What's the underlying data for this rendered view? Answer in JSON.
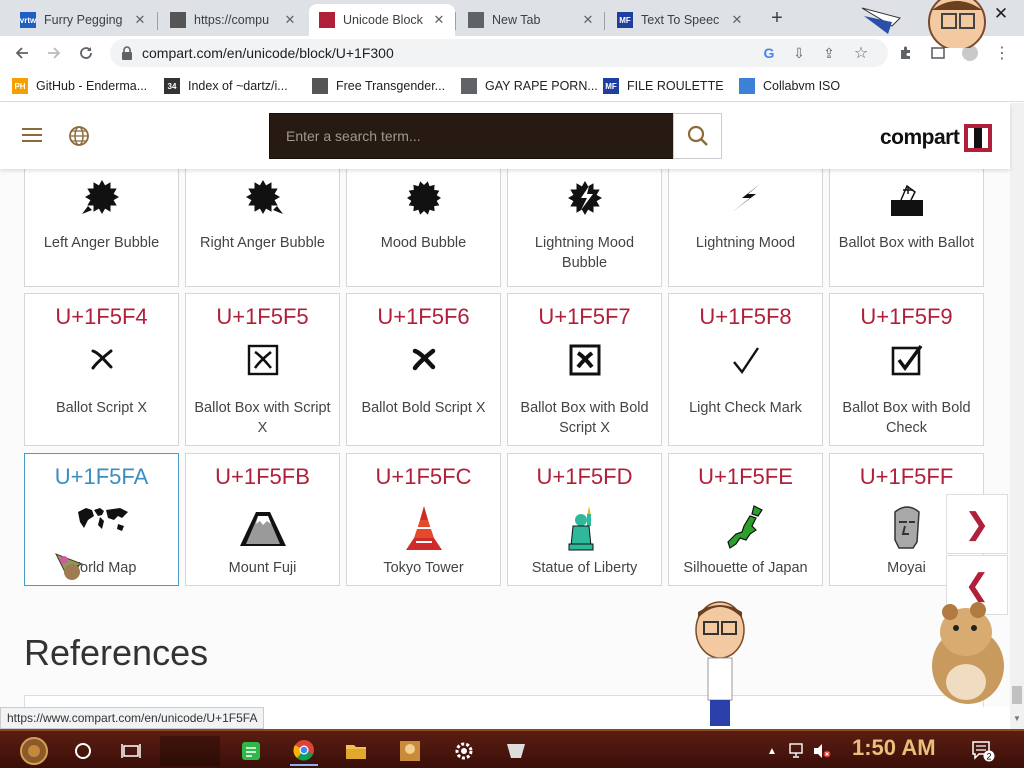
{
  "browser": {
    "tabs": [
      {
        "title": "Furry Pegging V",
        "fav_text": "vrtw",
        "fav_color": "#1f5fbf"
      },
      {
        "title": "https://compu",
        "fav_text": "",
        "fav_color": "#555"
      },
      {
        "title": "Unicode Block",
        "fav_text": "",
        "fav_color": "#b0203a"
      },
      {
        "title": "New Tab",
        "fav_text": "",
        "fav_color": "#5f6368"
      },
      {
        "title": "Text To Speec",
        "fav_text": "MF",
        "fav_color": "#1f3fa0"
      }
    ],
    "active_tab_index": 2,
    "url": "compart.com/en/unicode/block/U+1F300",
    "bookmarks": [
      {
        "label": "GitHub - Enderma...",
        "fav_text": "PH",
        "fav_color": "#f5a000"
      },
      {
        "label": "Index of ~dartz/i...",
        "fav_text": "34",
        "fav_color": "#333"
      },
      {
        "label": "Free Transgender...",
        "fav_text": "",
        "fav_color": "#555"
      },
      {
        "label": "GAY RAPE PORN...",
        "fav_text": "",
        "fav_color": "#5f6368"
      },
      {
        "label": "FILE ROULETTE",
        "fav_text": "MF",
        "fav_color": "#1f3fa0"
      },
      {
        "label": "Collabvm ISO",
        "fav_text": "",
        "fav_color": "#3b82d6"
      }
    ],
    "status_url": "https://www.compart.com/en/unicode/U+1F5FA"
  },
  "site": {
    "search_placeholder": "Enter a search term...",
    "logo_text": "compart"
  },
  "grid": {
    "rows": [
      [
        {
          "code": "",
          "name": "Left Anger Bubble",
          "glyph": "anger-left"
        },
        {
          "code": "",
          "name": "Right Anger Bubble",
          "glyph": "anger-right"
        },
        {
          "code": "",
          "name": "Mood Bubble",
          "glyph": "mood"
        },
        {
          "code": "",
          "name": "Lightning Mood Bubble",
          "glyph": "lightning-bubble"
        },
        {
          "code": "",
          "name": "Lightning Mood",
          "glyph": "lightning"
        },
        {
          "code": "",
          "name": "Ballot Box with Ballot",
          "glyph": "ballot-box"
        }
      ],
      [
        {
          "code": "U+1F5F4",
          "name": "Ballot Script X",
          "glyph": "script-x"
        },
        {
          "code": "U+1F5F5",
          "name": "Ballot Box with Script X",
          "glyph": "box-script-x"
        },
        {
          "code": "U+1F5F6",
          "name": "Ballot Bold Script X",
          "glyph": "bold-script-x"
        },
        {
          "code": "U+1F5F7",
          "name": "Ballot Box with Bold Script X",
          "glyph": "box-bold-x"
        },
        {
          "code": "U+1F5F8",
          "name": "Light Check Mark",
          "glyph": "check"
        },
        {
          "code": "U+1F5F9",
          "name": "Ballot Box with Bold Check",
          "glyph": "box-check"
        }
      ],
      [
        {
          "code": "U+1F5FA",
          "name": "World Map",
          "glyph": "world-map",
          "highlighted": true
        },
        {
          "code": "U+1F5FB",
          "name": "Mount Fuji",
          "glyph": "fuji"
        },
        {
          "code": "U+1F5FC",
          "name": "Tokyo Tower",
          "glyph": "tower"
        },
        {
          "code": "U+1F5FD",
          "name": "Statue of Liberty",
          "glyph": "liberty"
        },
        {
          "code": "U+1F5FE",
          "name": "Silhouette of Japan",
          "glyph": "japan"
        },
        {
          "code": "U+1F5FF",
          "name": "Moyai",
          "glyph": "moyai"
        }
      ]
    ]
  },
  "references_heading": "References",
  "nav": {
    "next_glyph": "❯",
    "prev_glyph": "❮"
  },
  "taskbar": {
    "clock": "1:50 AM",
    "notification_count": "2"
  },
  "colors": {
    "code_red": "#b0203a",
    "code_blue": "#3a8fc0",
    "search_bg": "#261a13",
    "taskbar_bg": "#4a150c"
  }
}
